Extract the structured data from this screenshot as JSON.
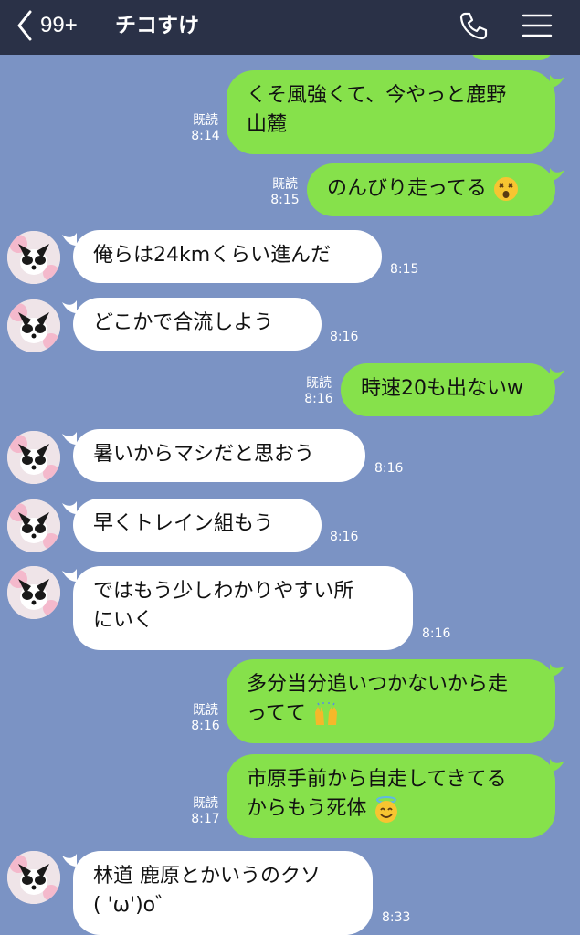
{
  "header": {
    "back_count": "99+",
    "title": "チコすけ",
    "icons": [
      "chevron-left-icon",
      "phone-icon",
      "menu-icon"
    ]
  },
  "colors": {
    "header_bg": "#2a3147",
    "chat_bg": "#7b93c4",
    "outgoing_bubble": "#86e14b",
    "incoming_bubble": "#ffffff"
  },
  "messages": [
    {
      "dir": "out",
      "lines": [
        "くそ風強くて、今やっと鹿野",
        "山麓"
      ],
      "read": "既読",
      "time": "8:14"
    },
    {
      "dir": "out",
      "lines": [
        "のんびり走ってる"
      ],
      "emoji": "dizzy-face-emoji",
      "read": "既読",
      "time": "8:15"
    },
    {
      "dir": "in",
      "lines": [
        "俺らは24kmくらい進んだ"
      ],
      "time": "8:15"
    },
    {
      "dir": "in",
      "lines": [
        "どこかで合流しよう"
      ],
      "time": "8:16"
    },
    {
      "dir": "out",
      "lines": [
        "時速20も出ないw"
      ],
      "read": "既読",
      "time": "8:16"
    },
    {
      "dir": "in",
      "lines": [
        "暑いからマシだと思おう"
      ],
      "time": "8:16"
    },
    {
      "dir": "in",
      "lines": [
        "早くトレイン組もう"
      ],
      "time": "8:16"
    },
    {
      "dir": "in",
      "lines": [
        "ではもう少しわかりやすい所",
        "にいく"
      ],
      "time": "8:16"
    },
    {
      "dir": "out",
      "lines": [
        "多分当分追いつかないから走",
        "ってて"
      ],
      "emoji": "raising-hands-emoji",
      "read": "既読",
      "time": "8:16"
    },
    {
      "dir": "out",
      "lines": [
        "市原手前から自走してきてる",
        "からもう死体"
      ],
      "emoji": "halo-face-emoji",
      "read": "既読",
      "time": "8:17"
    },
    {
      "dir": "in",
      "lines": [
        "林道 鹿原とかいうのクソ",
        "( 'ω')o゛"
      ],
      "time": "8:33"
    }
  ]
}
